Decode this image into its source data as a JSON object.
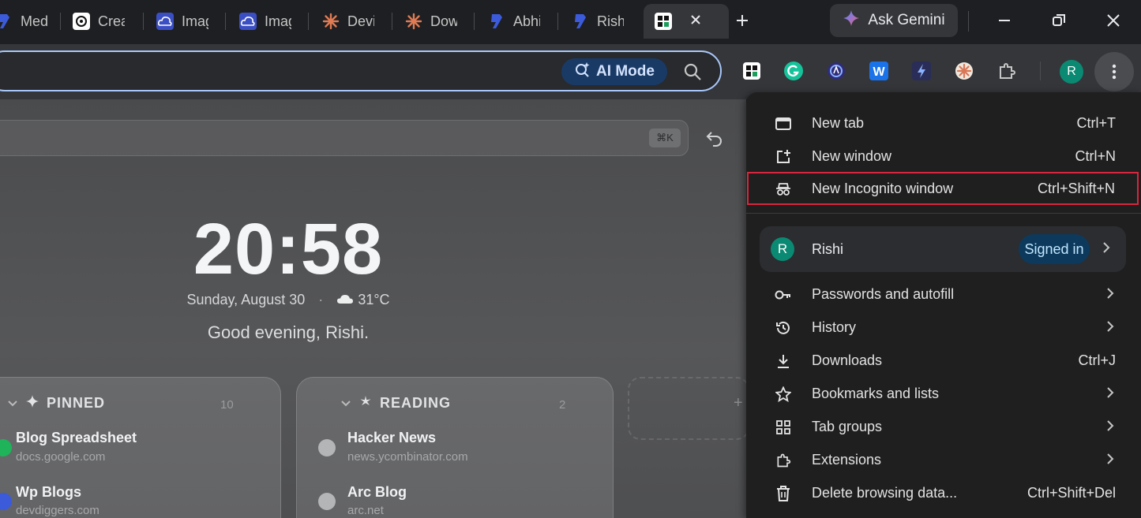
{
  "tabs": [
    {
      "label": "Med",
      "icon": "blue-logo-icon"
    },
    {
      "label": "Crea",
      "icon": "chatgpt-icon"
    },
    {
      "label": "Imag",
      "icon": "cloud-upload-icon"
    },
    {
      "label": "Imag",
      "icon": "cloud-upload-icon"
    },
    {
      "label": "Devi",
      "icon": "claude-icon"
    },
    {
      "label": "Dow",
      "icon": "claude-icon"
    },
    {
      "label": "Abhi",
      "icon": "blue-logo-icon"
    },
    {
      "label": "Rish",
      "icon": "blue-logo-icon"
    }
  ],
  "gemini": {
    "label": "Ask Gemini"
  },
  "omnibox": {
    "ai_mode": "AI Mode"
  },
  "profile_initial": "R",
  "page": {
    "shortcut": "⌘K",
    "time": "20:58",
    "date": "Sunday, August 30",
    "separator": "·",
    "temperature": "31°C",
    "greeting": "Good evening, Rishi.",
    "pinned": {
      "title": "PINNED",
      "count": "10",
      "items": [
        {
          "title": "Blog Spreadsheet",
          "url": "docs.google.com"
        },
        {
          "title": "Wp Blogs",
          "url": "devdiggers.com"
        }
      ]
    },
    "reading": {
      "title": "READING",
      "count": "2",
      "items": [
        {
          "title": "Hacker News",
          "url": "news.ycombinator.com"
        },
        {
          "title": "Arc Blog",
          "url": "arc.net"
        }
      ]
    },
    "add_symbol": "+"
  },
  "menu": {
    "new_tab": {
      "label": "New tab",
      "shortcut": "Ctrl+T"
    },
    "new_window": {
      "label": "New window",
      "shortcut": "Ctrl+N"
    },
    "new_incognito": {
      "label": "New Incognito window",
      "shortcut": "Ctrl+Shift+N"
    },
    "profile": {
      "name": "Rishi",
      "status": "Signed in",
      "initial": "R"
    },
    "passwords": {
      "label": "Passwords and autofill"
    },
    "history": {
      "label": "History"
    },
    "downloads": {
      "label": "Downloads",
      "shortcut": "Ctrl+J"
    },
    "bookmarks": {
      "label": "Bookmarks and lists"
    },
    "tab_groups": {
      "label": "Tab groups"
    },
    "extensions": {
      "label": "Extensions"
    },
    "delete_data": {
      "label": "Delete browsing data...",
      "shortcut": "Ctrl+Shift+Del"
    }
  },
  "colors": {
    "accent": "#a8c7fa",
    "highlight_border": "#d7263d",
    "avatar": "#0b8a73"
  }
}
